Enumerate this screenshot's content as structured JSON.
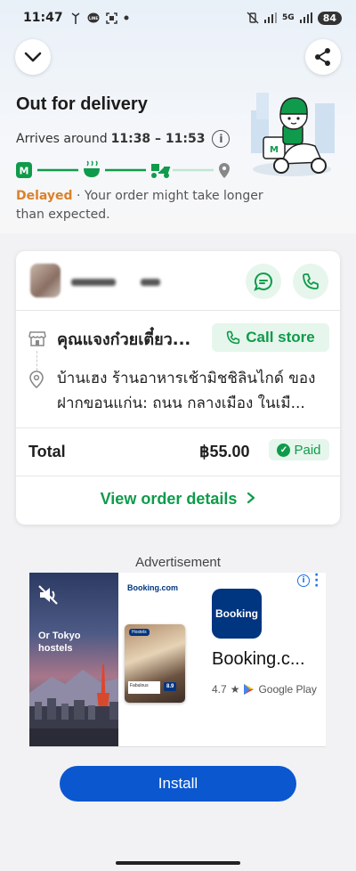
{
  "status_bar": {
    "time": "11:47",
    "network_5g": "5G",
    "battery": "84"
  },
  "header": {
    "title": "Out for delivery",
    "eta_prefix": "Arrives around",
    "eta_time": "11:38 – 11:53",
    "progress_step_icons": [
      "store-icon",
      "food-bowl-icon",
      "delivery-scooter-icon",
      "location-pin-icon"
    ],
    "delayed_tag": "Delayed",
    "delayed_message": " · Your order might take longer than expected."
  },
  "order_card": {
    "call_store_label": "Call store",
    "store_name": "คุณแจงก๋วยเตี๋ยว...",
    "address": "บ้านเฮง ร้านอาหารเช้ามิชชิลินไกด์ ของ ฝากขอนแก่น: ถนน กลางเมือง ในเมื...",
    "total_label": "Total",
    "total_amount": "฿55.00",
    "paid_label": "Paid",
    "view_details_label": "View order details"
  },
  "ad": {
    "label": "Advertisement",
    "caption": "Or Tokyo hostels",
    "brand_text": "Booking.com",
    "hostels_chip": "Hostels",
    "photo_review": "Fabulous",
    "photo_score": "8.9",
    "app_icon_text": "Booking",
    "app_name": "Booking.c...",
    "rating": "4.7",
    "store_name": "Google Play",
    "install_label": "Install"
  },
  "colors": {
    "brand_green": "#0f9b4b",
    "delay_orange": "#d9822b",
    "install_blue": "#0b57d0",
    "booking_blue": "#003580"
  }
}
